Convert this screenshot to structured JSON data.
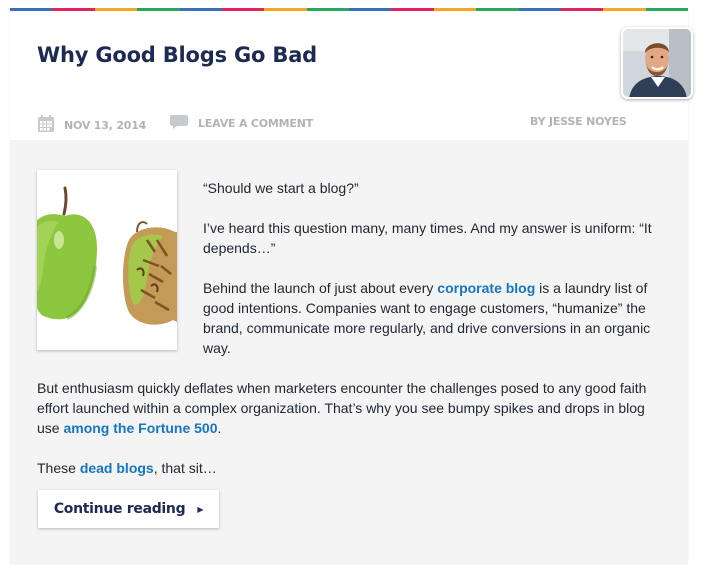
{
  "post": {
    "title": "Why Good Blogs Go Bad",
    "date": "NOV 13, 2014",
    "comment_link": "LEAVE A COMMENT",
    "author": "BY JESSE NOYES"
  },
  "colors": {
    "stripe": [
      "#3b6fb6",
      "#e0245e",
      "#f5a623",
      "#27a85f",
      "#1d2a52",
      "#8bc34a",
      "#00a0d2",
      "#e8542e"
    ],
    "title": "#1d2a52",
    "link": "#1676bf",
    "meta": "#b0b4b8"
  },
  "body": {
    "p1": "“Should we start a blog?”",
    "p2": "I’ve heard this question many, many times. And my answer is uniform: “It depends…”",
    "p3_before": "Behind the launch of just about every ",
    "p3_link": "corporate blog",
    "p3_after": " is a laundry list of good intentions. Companies want to engage customers, “humanize” the brand, communicate more regularly, and drive conversions in an organic way.",
    "p4_before": "But enthusiasm quickly deflates when marketers encounter the challenges posed to any good faith effort launched within a complex organization. That’s why you see bumpy spikes and drops in blog use ",
    "p4_link": "among the Fortune 500",
    "p4_after": ".",
    "p5_before": "These ",
    "p5_link": "dead blogs",
    "p5_after": ", that sit…"
  },
  "button": {
    "label": "Continue reading"
  },
  "icons": {
    "date": "calendar-icon",
    "comment": "speech-bubble-icon",
    "button": "triangle-right-icon"
  }
}
